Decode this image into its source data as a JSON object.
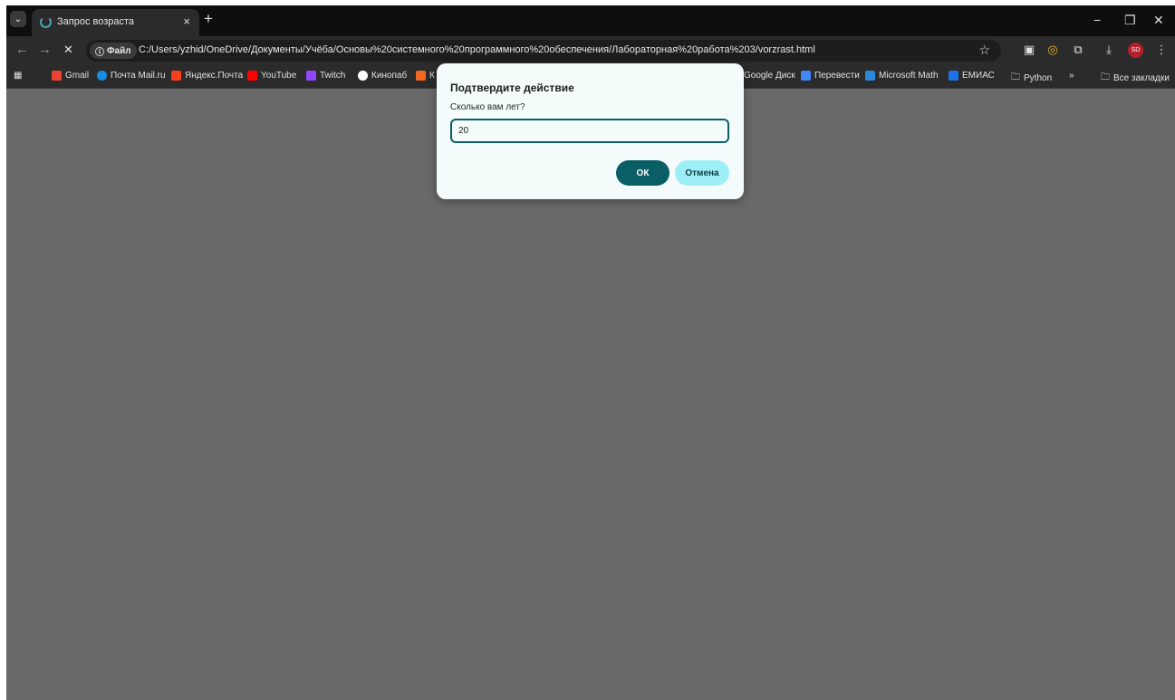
{
  "tab": {
    "title": "Запрос возраста",
    "close_glyph": "×",
    "new_tab_glyph": "+"
  },
  "window_controls": {
    "minimize": "−",
    "maximize": "❐",
    "close": "✕"
  },
  "toolbar": {
    "back": "←",
    "forward": "→",
    "stop": "✕",
    "site_chip": "Файл",
    "url": "C:/Users/yzhid/OneDrive/Документы/Учёба/Основы%20системного%20программного%20обеспечения/Лабораторная%20работа%203/vorzrast.html",
    "profile_initials": "SD"
  },
  "bookmarks": [
    {
      "label": "Gmail",
      "color": "#ea4335"
    },
    {
      "label": "Почта Mail.ru",
      "color": "#168de2"
    },
    {
      "label": "Яндекс.Почта",
      "color": "#fc3f1d"
    },
    {
      "label": "YouTube",
      "color": "#ff0000"
    },
    {
      "label": "Twitch",
      "color": "#9146ff"
    },
    {
      "label": "Кинопаб",
      "color": "#ffffff"
    },
    {
      "label": "К",
      "color": "#f26722"
    },
    {
      "label": "Google Диск",
      "color": "#1fa463"
    },
    {
      "label": "Перевести",
      "color": "#4285f4"
    },
    {
      "label": "Microsoft Math",
      "color": "#2b88d8"
    },
    {
      "label": "ЕМИАС",
      "color": "#1a73e8"
    },
    {
      "label": "Python",
      "color": ""
    },
    {
      "label": "»",
      "color": ""
    },
    {
      "label": "Все закладки",
      "color": ""
    }
  ],
  "dialog": {
    "title": "Подтвердите действие",
    "message": "Сколько вам лет?",
    "input_value": "20",
    "ok_label": "ОК",
    "cancel_label": "Отмена"
  },
  "colors": {
    "accent": "#0a5e66",
    "cancel_bg": "#9eeef8",
    "overlay": "#696969"
  }
}
